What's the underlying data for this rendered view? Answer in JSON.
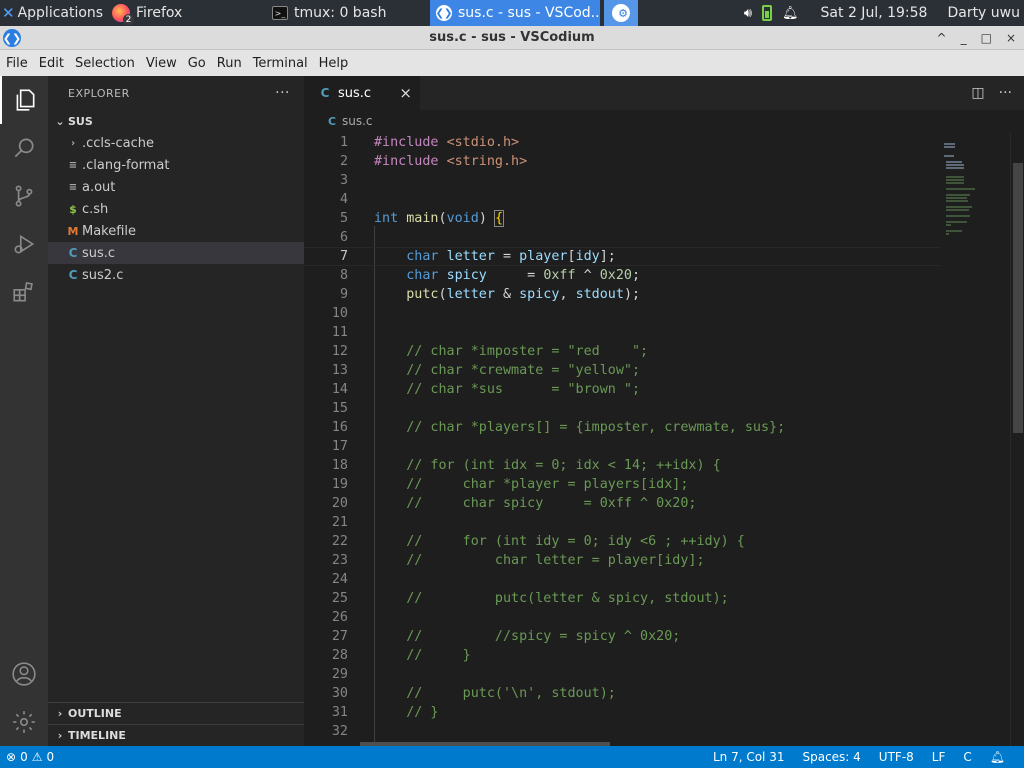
{
  "panel": {
    "applications": "Applications",
    "tasks": [
      {
        "label": "Firefox",
        "badge": "2"
      },
      {
        "label": "tmux: 0 bash"
      },
      {
        "label": "sus.c - sus - VSCod..."
      }
    ],
    "clock": "Sat  2 Jul, 19:58",
    "user": "Darty uwu"
  },
  "window": {
    "title": "sus.c - sus - VSCodium",
    "buttons": [
      "^",
      "_",
      "□",
      "×"
    ]
  },
  "menu": [
    "File",
    "Edit",
    "Selection",
    "View",
    "Go",
    "Run",
    "Terminal",
    "Help"
  ],
  "sidebar": {
    "header": "EXPLORER",
    "more": "···",
    "folder": "SUS",
    "items": [
      {
        "label": ".ccls-cache",
        "icon": "chevron-right-icon",
        "glyph": "›"
      },
      {
        "label": ".clang-format",
        "icon": "lines-icon",
        "glyph": "≡"
      },
      {
        "label": "a.out",
        "icon": "lines-icon",
        "glyph": "≡"
      },
      {
        "label": "c.sh",
        "icon": "shell-icon",
        "glyph": "$"
      },
      {
        "label": "Makefile",
        "icon": "makefile-icon",
        "glyph": "M"
      },
      {
        "label": "sus.c",
        "icon": "c-file-icon",
        "glyph": "C"
      },
      {
        "label": "sus2.c",
        "icon": "c-file-icon",
        "glyph": "C"
      }
    ],
    "sections": [
      "OUTLINE",
      "TIMELINE"
    ]
  },
  "editor": {
    "tab": {
      "label": "sus.c",
      "close": "×"
    },
    "breadcrumb": "sus.c",
    "current_line": 7
  },
  "code": [
    {
      "n": "1",
      "t": "#include <stdio.h>"
    },
    {
      "n": "2",
      "t": "#include <string.h>"
    },
    {
      "n": "3",
      "t": ""
    },
    {
      "n": "4",
      "t": ""
    },
    {
      "n": "5",
      "t": "int main(void) {"
    },
    {
      "n": "6",
      "t": ""
    },
    {
      "n": "7",
      "t": "    char letter = player[idy];"
    },
    {
      "n": "8",
      "t": "    char spicy     = 0xff ^ 0x20;"
    },
    {
      "n": "9",
      "t": "    putc(letter & spicy, stdout);"
    },
    {
      "n": "10",
      "t": ""
    },
    {
      "n": "11",
      "t": ""
    },
    {
      "n": "12",
      "t": "    // char *imposter = \"red    \";"
    },
    {
      "n": "13",
      "t": "    // char *crewmate = \"yellow\";"
    },
    {
      "n": "14",
      "t": "    // char *sus      = \"brown \";"
    },
    {
      "n": "15",
      "t": ""
    },
    {
      "n": "16",
      "t": "    // char *players[] = {imposter, crewmate, sus};"
    },
    {
      "n": "17",
      "t": ""
    },
    {
      "n": "18",
      "t": "    // for (int idx = 0; idx < 14; ++idx) {"
    },
    {
      "n": "19",
      "t": "    //     char *player = players[idx];"
    },
    {
      "n": "20",
      "t": "    //     char spicy     = 0xff ^ 0x20;"
    },
    {
      "n": "21",
      "t": ""
    },
    {
      "n": "22",
      "t": "    //     for (int idy = 0; idy <6 ; ++idy) {"
    },
    {
      "n": "23",
      "t": "    //         char letter = player[idy];"
    },
    {
      "n": "24",
      "t": ""
    },
    {
      "n": "25",
      "t": "    //         putc(letter & spicy, stdout);"
    },
    {
      "n": "26",
      "t": ""
    },
    {
      "n": "27",
      "t": "    //         //spicy = spicy ^ 0x20;"
    },
    {
      "n": "28",
      "t": "    //     }"
    },
    {
      "n": "29",
      "t": ""
    },
    {
      "n": "30",
      "t": "    //     putc('\\n', stdout);"
    },
    {
      "n": "31",
      "t": "    // }"
    },
    {
      "n": "32",
      "t": ""
    }
  ],
  "status": {
    "errors": "0",
    "warnings": "0",
    "position": "Ln 7, Col 31",
    "spaces": "Spaces: 4",
    "encoding": "UTF-8",
    "eol": "LF",
    "language": "C"
  },
  "colors": {
    "statusbar": "#007acc",
    "activity_bar": "#333333",
    "sidebar": "#252526",
    "editor": "#1e1e1e",
    "active_task": "#3d86e6"
  }
}
